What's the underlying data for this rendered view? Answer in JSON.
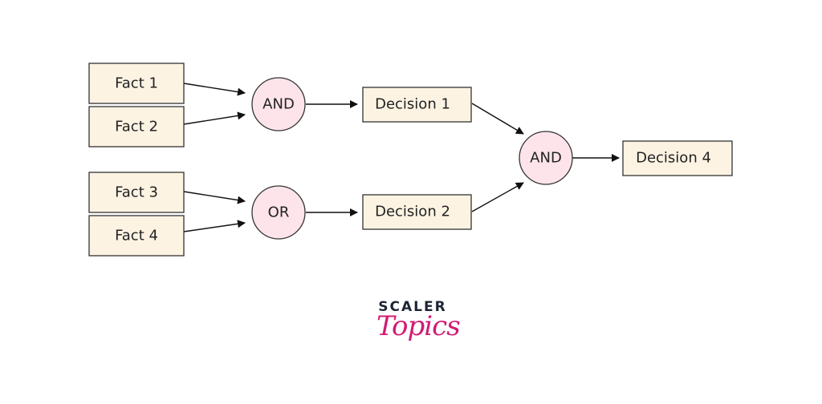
{
  "diagram": {
    "facts": [
      "Fact 1",
      "Fact 2",
      "Fact 3",
      "Fact 4"
    ],
    "gates": [
      "AND",
      "OR",
      "AND"
    ],
    "decisions": [
      "Decision 1",
      "Decision 2",
      "Decision 4"
    ],
    "colors": {
      "box_fill": "#fdf3e3",
      "gate_fill": "#fde4ea",
      "logo_accent": "#d11c73",
      "logo_dark": "#1d2433"
    },
    "edges": [
      [
        "Fact 1",
        "AND (1)"
      ],
      [
        "Fact 2",
        "AND (1)"
      ],
      [
        "Fact 3",
        "OR"
      ],
      [
        "Fact 4",
        "OR"
      ],
      [
        "AND (1)",
        "Decision 1"
      ],
      [
        "OR",
        "Decision 2"
      ],
      [
        "Decision 1",
        "AND (2)"
      ],
      [
        "Decision 2",
        "AND (2)"
      ],
      [
        "AND (2)",
        "Decision 4"
      ]
    ]
  },
  "logo": {
    "top": "SCALER",
    "bottom": "Topics"
  }
}
